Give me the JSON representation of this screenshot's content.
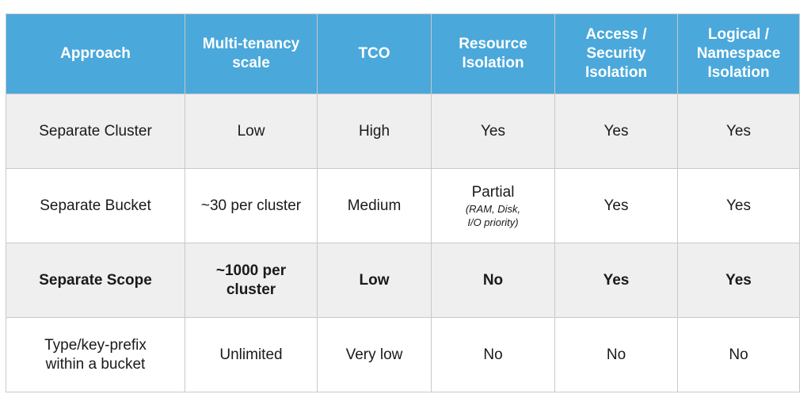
{
  "table": {
    "headers": [
      "Approach",
      "Multi-tenancy\nscale",
      "TCO",
      "Resource\nIsolation",
      "Access /\nSecurity\nIsolation",
      "Logical /\nNamespace\nIsolation"
    ],
    "rows": [
      {
        "cells": [
          "Separate Cluster",
          "Low",
          "High",
          "Yes",
          "Yes",
          "Yes"
        ],
        "resource_note": ""
      },
      {
        "cells": [
          "Separate Bucket",
          "~30 per cluster",
          "Medium",
          "Partial",
          "Yes",
          "Yes"
        ],
        "resource_note": "(RAM, Disk,\nI/O priority)"
      },
      {
        "cells": [
          "Separate Scope",
          "~1000 per\ncluster",
          "Low",
          "No",
          "Yes",
          "Yes"
        ],
        "resource_note": ""
      },
      {
        "cells": [
          "Type/key-prefix\nwithin a bucket",
          "Unlimited",
          "Very low",
          "No",
          "No",
          "No"
        ],
        "resource_note": ""
      }
    ]
  },
  "colors": {
    "header_bg": "#4aa8db",
    "shaded_row": "#efefef",
    "border": "#c8c8c8"
  }
}
